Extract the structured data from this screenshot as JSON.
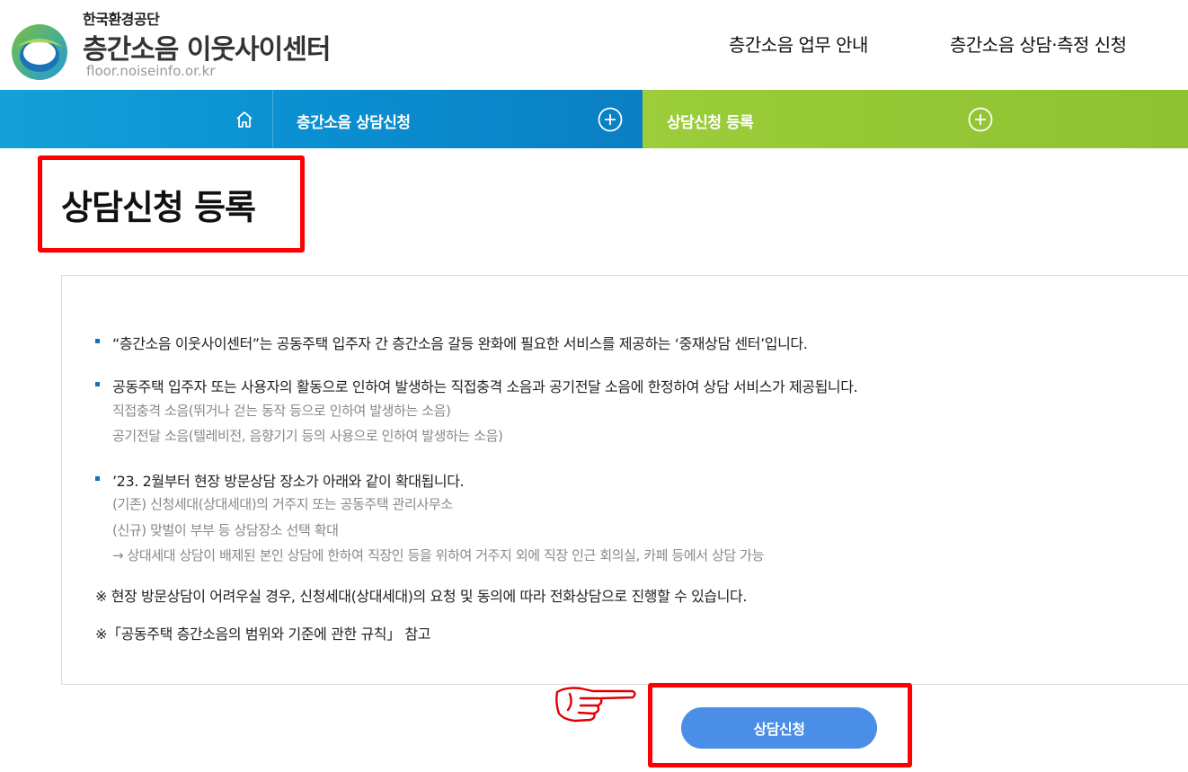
{
  "header": {
    "org_name": "한국환경공단",
    "site_title": "층간소음 이웃사이센터",
    "site_url": "floor.noiseinfo.or.kr",
    "top_nav": [
      "층간소음 업무 안내",
      "층간소음 상담·측정 신청"
    ]
  },
  "navbar": {
    "home_icon": "home-icon",
    "items": [
      {
        "label": "층간소음 상담신청",
        "icon": "plus-circle-icon"
      },
      {
        "label": "상담신청 등록",
        "icon": "plus-circle-icon"
      }
    ],
    "colors": {
      "blue": "#0a8fd0",
      "green": "#8ec231"
    }
  },
  "page": {
    "title": "상담신청 등록"
  },
  "content": {
    "items": [
      {
        "text": "“층간소음 이웃사이센터”는 공동주택 입주자 간 층간소음 갈등 완화에 필요한 서비스를 제공하는 ‘중재상담 센터’입니다."
      },
      {
        "text": "공동주택 입주자 또는 사용자의 활동으로 인하여 발생하는 직접충격 소음과 공기전달 소음에 한정하여 상담 서비스가 제공됩니다.",
        "subs": [
          "직접충격 소음(뛰거나 걷는 동작 등으로 인하여 발생하는 소음)",
          "공기전달 소음(텔레비전, 음향기기 등의 사용으로 인하여 발생하는 소음)"
        ]
      },
      {
        "text": "’23. 2월부터 현장 방문상담 장소가 아래와 같이 확대됩니다.",
        "subs": [
          "(기존) 신청세대(상대세대)의 거주지 또는 공동주택 관리사무소",
          "(신규) 맞벌이 부부 등 상담장소 선택 확대",
          "→ 상대세대 상담이 배제된 본인 상담에 한하여 직장인 등을 위하여 거주지 외에 직장 인근 회의실, 카페 등에서 상담 가능"
        ]
      }
    ],
    "notes": [
      "※ 현장 방문상담이 어려우실 경우, 신청세대(상대세대)의 요청 및 동의에 따라 전화상담으로 진행할 수 있습니다.",
      "※「공동주택 층간소음의 범위와 기준에 관한 규칙」 참고"
    ]
  },
  "action": {
    "apply_label": "상담신청",
    "pointer_icon": "pointing-hand-icon",
    "button_color": "#4a8ee8",
    "highlight_color": "#ff0000"
  }
}
